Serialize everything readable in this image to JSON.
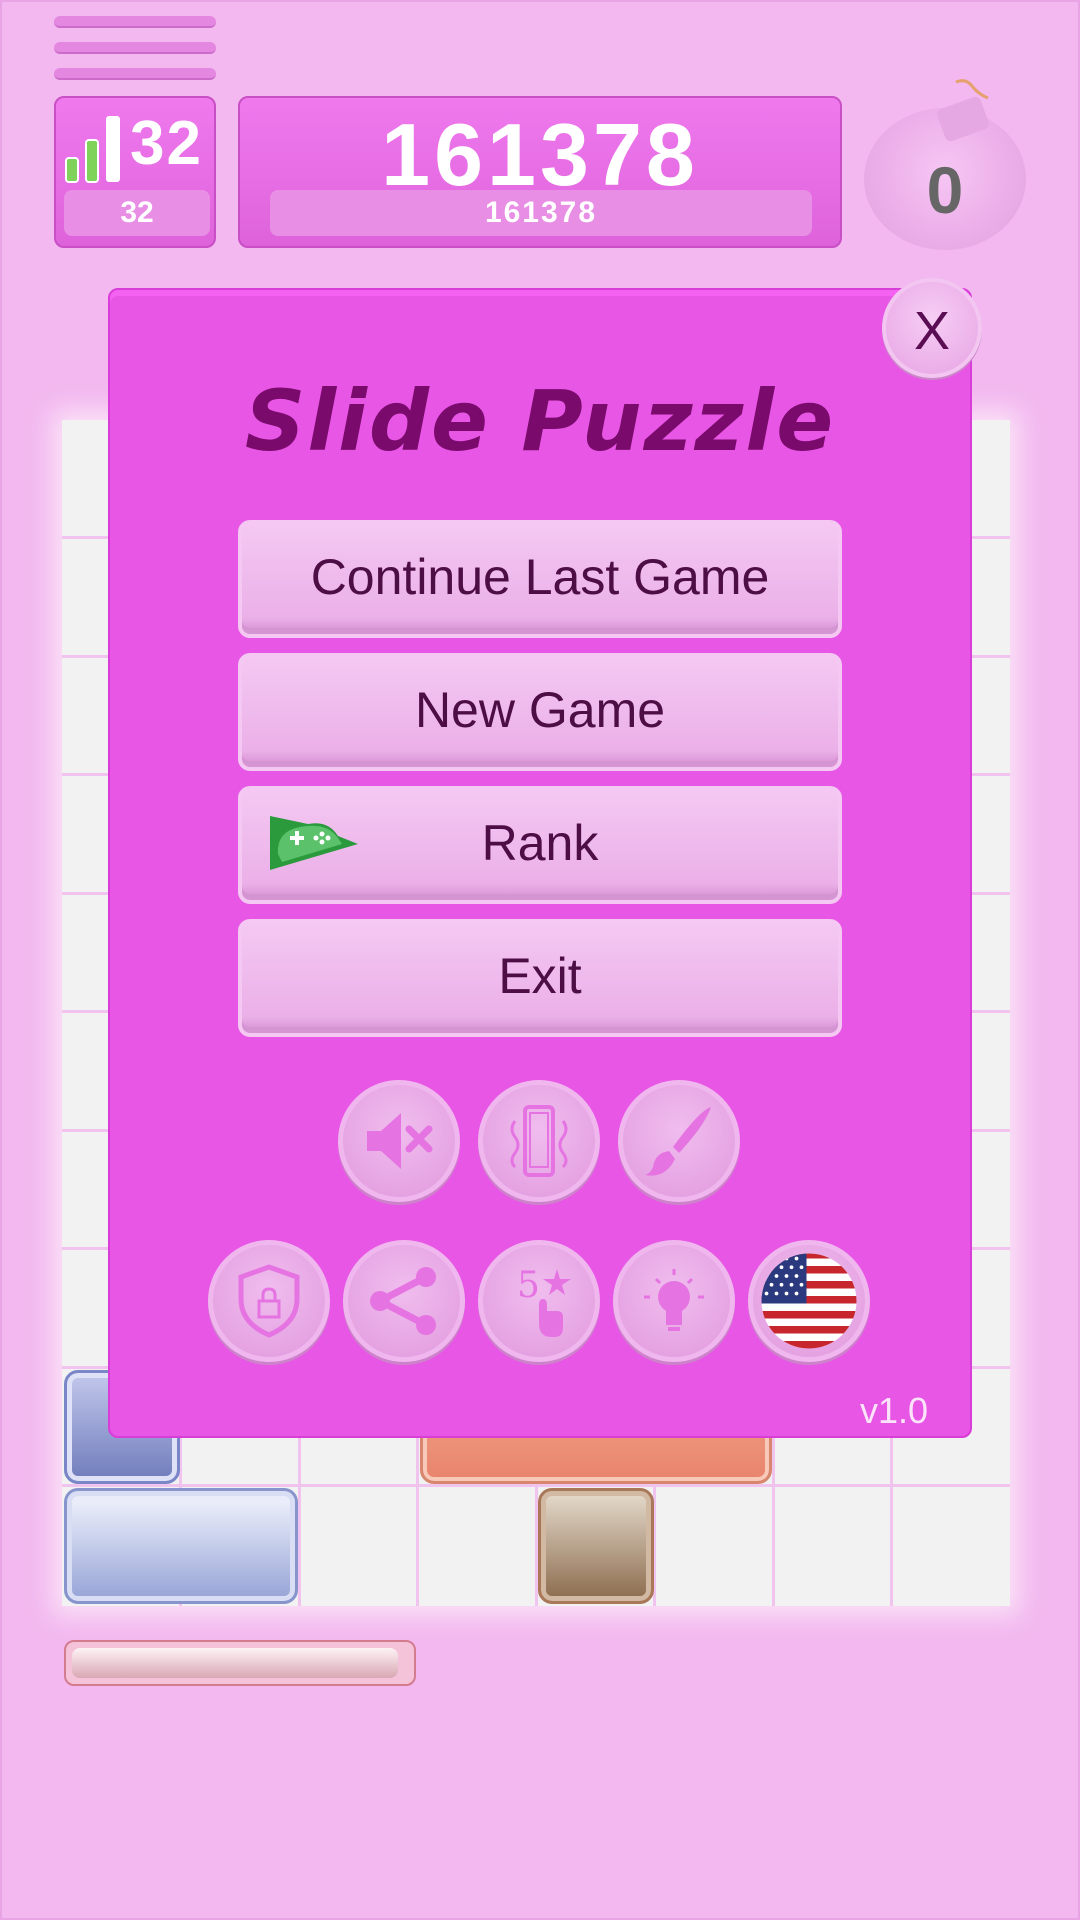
{
  "hud": {
    "level_value": "32",
    "level_sub": "32",
    "score_value": "161378",
    "score_sub": "161378",
    "bomb_count": "0"
  },
  "dialog": {
    "title": "Slide Puzzle",
    "close_label": "X",
    "buttons": {
      "continue": "Continue Last Game",
      "new_game": "New Game",
      "rank": "Rank",
      "exit": "Exit"
    },
    "version": "v1.0"
  },
  "icons": {
    "row1": [
      "sound-muted-icon",
      "vibration-icon",
      "theme-brush-icon"
    ],
    "row2": [
      "privacy-shield-icon",
      "share-icon",
      "rate-five-stars-icon",
      "hint-lightbulb-icon",
      "language-flag-us-icon"
    ]
  },
  "progress": {
    "fraction": 0.97
  },
  "colors": {
    "accent": "#e856e6",
    "title": "#7a0a6b",
    "button_text": "#4d0d45",
    "background": "#f2b8ef"
  }
}
